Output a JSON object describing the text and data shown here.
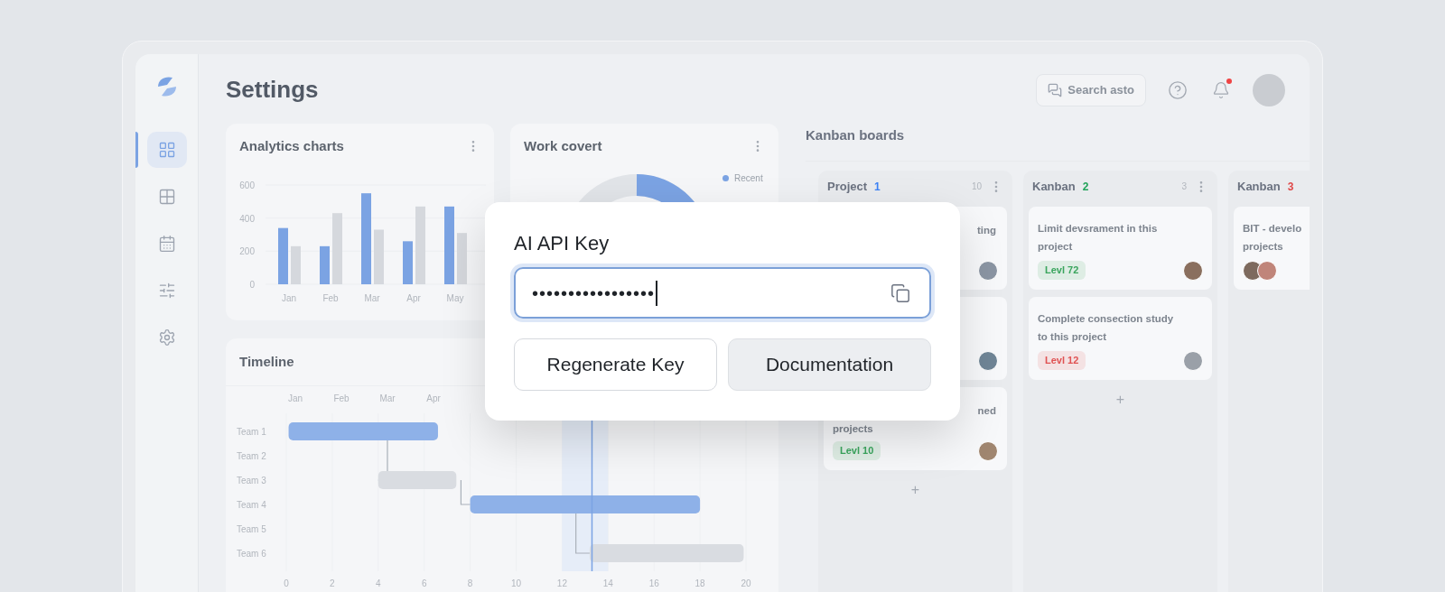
{
  "sidebar": {
    "items": [
      {
        "kind": "dashboard",
        "selected": true
      },
      {
        "kind": "apps",
        "selected": false
      },
      {
        "kind": "calendar",
        "selected": false
      },
      {
        "kind": "filters",
        "selected": false
      },
      {
        "kind": "settings",
        "selected": false
      }
    ]
  },
  "header": {
    "title": "Settings",
    "search": {
      "label": "Search asto"
    },
    "notifications": {
      "unread": true
    }
  },
  "analytics": {
    "title": "Analytics charts",
    "chart_data": {
      "type": "bar",
      "categories": [
        "Jan",
        "Feb",
        "Mar",
        "Apr",
        "May"
      ],
      "yticks": [
        0,
        200,
        400,
        600
      ],
      "ylim": [
        0,
        600
      ],
      "series": [
        {
          "color": "#7ba3e3",
          "values": [
            340,
            230,
            550,
            260,
            470
          ]
        },
        {
          "color": "#d5d8dd",
          "values": [
            230,
            430,
            330,
            470,
            310
          ]
        }
      ]
    }
  },
  "work": {
    "title": "Work covert",
    "legend": [
      {
        "label": "Recent"
      }
    ]
  },
  "timeline": {
    "title": "Timeline",
    "months": [
      "Jan",
      "Feb",
      "Mar",
      "Apr"
    ],
    "rows": [
      {
        "label": "Team 1"
      },
      {
        "label": "Team 2"
      },
      {
        "label": "Team 3"
      },
      {
        "label": "Team 4"
      },
      {
        "label": "Team 5"
      },
      {
        "label": "Team 6"
      }
    ],
    "ticks": [
      "0",
      "2",
      "4",
      "6",
      "8",
      "10",
      "12",
      "14",
      "16",
      "18",
      "20"
    ]
  },
  "kanban": {
    "title": "Kanban boards",
    "columns": [
      {
        "name": "Project",
        "badge": "1",
        "color": "#3b82f6",
        "count": "10",
        "add": "+",
        "cards": [
          {
            "kind": "covered",
            "lines": [
              "ting"
            ],
            "avatars": [
              {
                "color": "#8b95a3"
              }
            ]
          },
          {
            "kind": "covered",
            "avatars": [
              {
                "color": "#6f8596"
              }
            ]
          },
          {
            "kind": "covered",
            "lines": [
              "ned",
              "projects"
            ],
            "tag": {
              "label": "Levl 10",
              "color": "#3aa55d"
            },
            "avatars": [
              {
                "color": "#a08670"
              }
            ]
          }
        ]
      },
      {
        "name": "Kanban",
        "badge": "2",
        "color": "#22a35a",
        "count": "3",
        "add": "+",
        "cards": [
          {
            "kind": "full",
            "lines": [
              "Limit devsrament in this",
              "project"
            ],
            "tag": {
              "label": "Levl 72",
              "color": "#3aa55d"
            },
            "avatars": [
              {
                "color": "#8a6f5e"
              }
            ]
          },
          {
            "kind": "full",
            "lines": [
              "Complete consection study",
              "to this project"
            ],
            "tag": {
              "label": "Levl 12",
              "color": "#e05252"
            },
            "avatars": [
              {
                "color": "#9aa0a8"
              }
            ]
          }
        ]
      },
      {
        "name": "Kanban",
        "badge": "3",
        "color": "#e04848",
        "cards": [
          {
            "kind": "full",
            "lines": [
              "BIT - develo",
              "projects"
            ],
            "avatars": [
              {
                "color": "#7d6a5e"
              },
              {
                "color": "#c0857a"
              }
            ]
          }
        ]
      }
    ]
  },
  "dialog": {
    "title": "AI API Key",
    "field": {
      "value": "•••••••••••••••••",
      "focused": true
    },
    "buttons": [
      {
        "label": "Regenerate Key",
        "kind": "outline"
      },
      {
        "label": "Documentation",
        "kind": "filled"
      }
    ]
  }
}
